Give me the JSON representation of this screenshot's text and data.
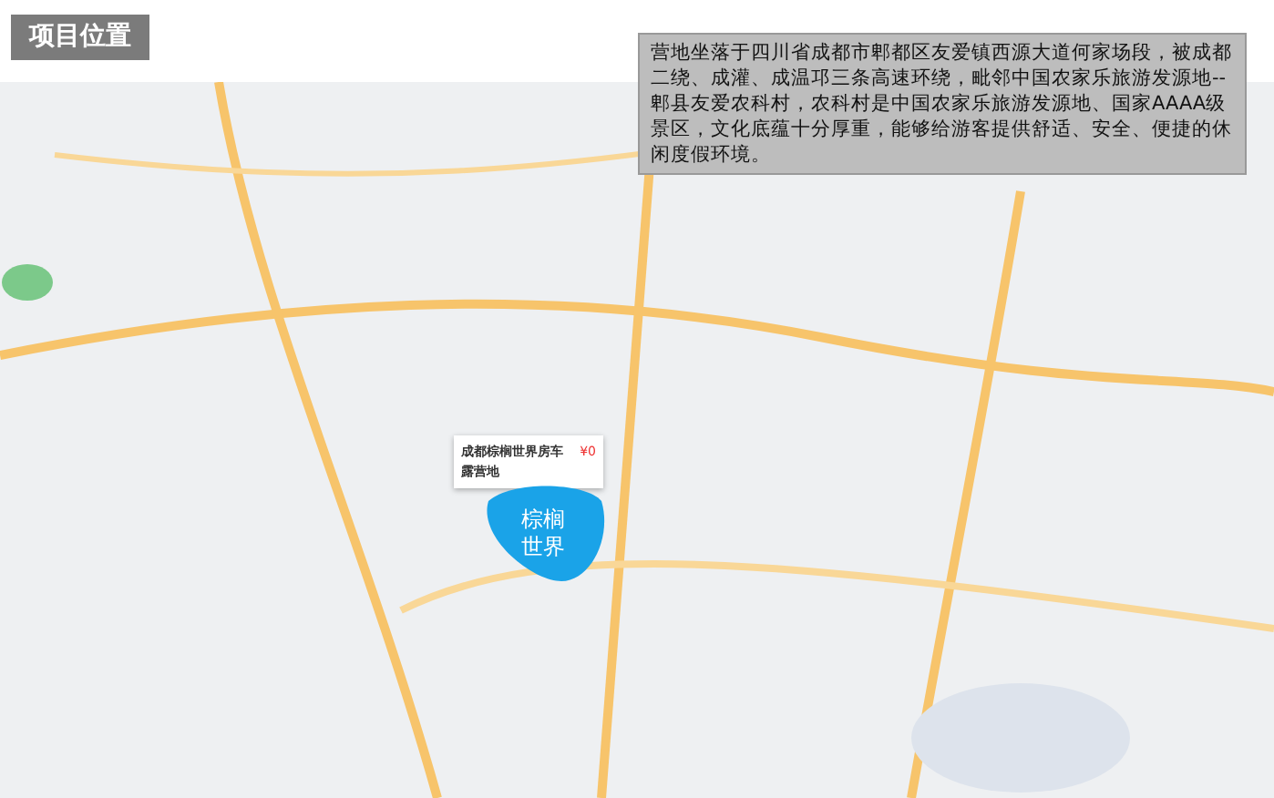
{
  "header": {
    "title": "项目位置"
  },
  "description": "营地坐落于四川省成都市郫都区友爱镇西源大道何家场段，被成都二绕、成灌、成温邛三条高速环绕，毗邻中国农家乐旅游发源地--郫县友爱农科村，农科村是中国农家乐旅游发源地、国家AAAA级景区，文化底蕴十分厚重，能够给游客提供舒适、安全、便捷的休闲度假环境。",
  "map_marker": {
    "name": "成都棕榈世界房车露营地",
    "price": "¥0"
  },
  "area_label": "棕榈世界"
}
